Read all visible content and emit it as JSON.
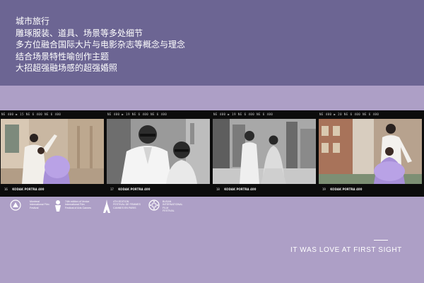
{
  "intro": {
    "lines": [
      "城市旅行",
      "雕琢服装、道具、场景等多处细节",
      "多方位融合国际大片与电影杂志等概念与理念",
      "结合场景特性喻创作主题",
      "大招超强融场感的超强婚照"
    ]
  },
  "filmstrip": {
    "frames": [
      {
        "code_top": "NE 400  ▶ 15   NE 6 400   NE 6  400",
        "number": "16",
        "brand": "KODAK PORTRA 400",
        "suffix": "400 36",
        "style": "color"
      },
      {
        "code_top": "NE 400  ▶ 19   NE 6 400   NE 6  400",
        "number": "17",
        "brand": "KODAK PORTRA 400",
        "suffix": "400 36",
        "style": "bw"
      },
      {
        "code_top": "NE 400  ▶ 19   NE 6 400   NE 6  400",
        "number": "18",
        "brand": "KODAK PORTRA 400",
        "suffix": "400 36",
        "style": "bw"
      },
      {
        "code_top": "NE 400  ▶ 20   NE 6 400   NE 6  400",
        "number": "19",
        "brand": "KODAK PORTRA 400",
        "suffix": "400 36",
        "style": "color"
      }
    ]
  },
  "festival_logos": [
    {
      "icon": "montreal-festival-icon",
      "text": "Montreal\nInternational Film\nFestival"
    },
    {
      "icon": "venice-festival-icon",
      "text": "74th edition of Venice\nInternational Film\nFestival of Arts Cannes"
    },
    {
      "icon": "eiffel-tower-icon",
      "text": "4TH EDITION\nFESTIVAL DE FEMMES\nCANNES EN PARIS"
    },
    {
      "icon": "busan-festival-icon",
      "text": "BUSAN\nINTERNATIONAL\nFILM\nFESTIVAL"
    }
  ],
  "tagline": "IT WAS LOVE AT FIRST SIGHT",
  "colors": {
    "top_band": "#6c6593",
    "bottom_band": "#ad9fc6",
    "film": "#0c0c0c",
    "lavender_dress": "#a78fd8"
  }
}
